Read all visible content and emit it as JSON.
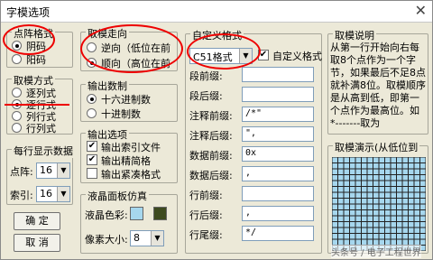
{
  "window": {
    "title": "字模选项",
    "close_glyph": "✕"
  },
  "dot_format": {
    "title": "点阵格式",
    "options": [
      "阴码",
      "阳码"
    ],
    "selected": 0
  },
  "scan_direction": {
    "title": "取模走向",
    "options": [
      "逆向（低位在前",
      "顺向（高位在前"
    ],
    "selected": 1
  },
  "scan_mode": {
    "title": "取模方式",
    "options": [
      "逐列式",
      "逐行式",
      "列行式",
      "行列式"
    ],
    "selected": 1
  },
  "output_base": {
    "title": "输出数制",
    "options": [
      "十六进制数",
      "十进制数"
    ],
    "selected": 0
  },
  "per_line": {
    "title": "每行显示数据",
    "dot_label": "点阵:",
    "dot_value": "16",
    "index_label": "索引:",
    "index_value": "16"
  },
  "output_opts": {
    "title": "输出选项",
    "items": [
      "输出索引文件",
      "输出精简格",
      "输出紧凑格式"
    ],
    "checked": [
      true,
      true,
      false
    ]
  },
  "lcd": {
    "title": "液晶面板仿真",
    "color_label": "液晶色彩:",
    "pixel_label": "像素大小:",
    "pixel_value": "8",
    "colors": [
      "#a6d7ee",
      "#3d4a1f"
    ]
  },
  "buttons": {
    "ok": "确 定",
    "cancel": "取 消"
  },
  "custom_format": {
    "title": "自定义格式",
    "format_value": "C51格式",
    "custom_check_label": "自定义格式",
    "rows": [
      {
        "label": "段前缀:",
        "value": ""
      },
      {
        "label": "段后缀:",
        "value": ""
      },
      {
        "label": "注释前缀:",
        "value": "/*\""
      },
      {
        "label": "注释后缀:",
        "value": "\","
      },
      {
        "label": "数据前缀:",
        "value": "0x"
      },
      {
        "label": "数据后缀:",
        "value": ","
      },
      {
        "label": "行前缀:",
        "value": ""
      },
      {
        "label": "行后缀:",
        "value": ","
      },
      {
        "label": "行尾缀:",
        "value": "*/"
      }
    ]
  },
  "explain": {
    "title": "取模说明",
    "text": "从第一行开始向右每取8个点作为一个字节，如果最后不足8点就补满8位。取模顺序是从高到低，即第一个点作为最高位。如*-------取为10000000"
  },
  "demo": {
    "title": "取模演示(从低位到"
  },
  "watermark": "头条号 / 电子工程世界"
}
